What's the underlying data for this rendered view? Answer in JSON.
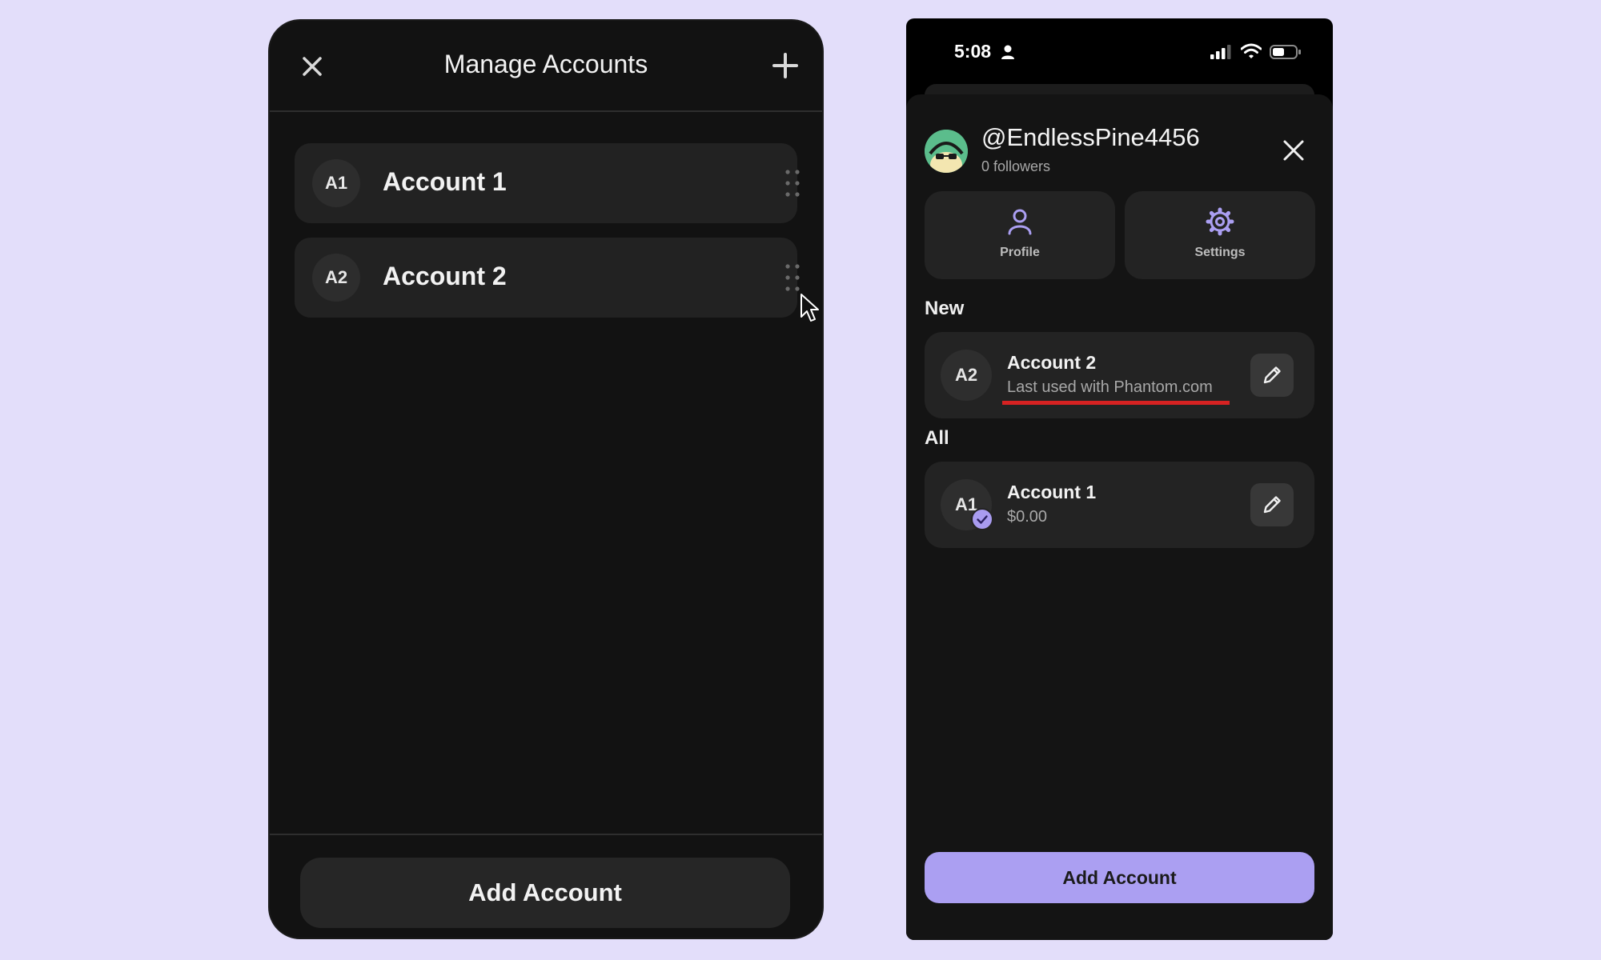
{
  "left_panel": {
    "title": "Manage Accounts",
    "accounts": [
      {
        "initials": "A1",
        "name": "Account 1"
      },
      {
        "initials": "A2",
        "name": "Account 2"
      }
    ],
    "add_button_label": "Add Account"
  },
  "right_panel": {
    "status_bar": {
      "time": "5:08"
    },
    "profile": {
      "username": "@EndlessPine4456",
      "followers": "0 followers"
    },
    "tiles": [
      {
        "label": "Profile",
        "icon": "person-icon"
      },
      {
        "label": "Settings",
        "icon": "gear-icon"
      }
    ],
    "sections": {
      "new_label": "New",
      "all_label": "All"
    },
    "new_accounts": [
      {
        "initials": "A2",
        "name": "Account 2",
        "subtitle": "Last used with Phantom.com"
      }
    ],
    "all_accounts": [
      {
        "initials": "A1",
        "name": "Account 1",
        "subtitle": "$0.00",
        "selected": true
      }
    ],
    "add_button_label": "Add Account"
  },
  "colors": {
    "background": "#e3defa",
    "panel": "#121212",
    "card": "#232323",
    "accent": "#ab9ff2",
    "highlight_underline": "#d62222"
  }
}
